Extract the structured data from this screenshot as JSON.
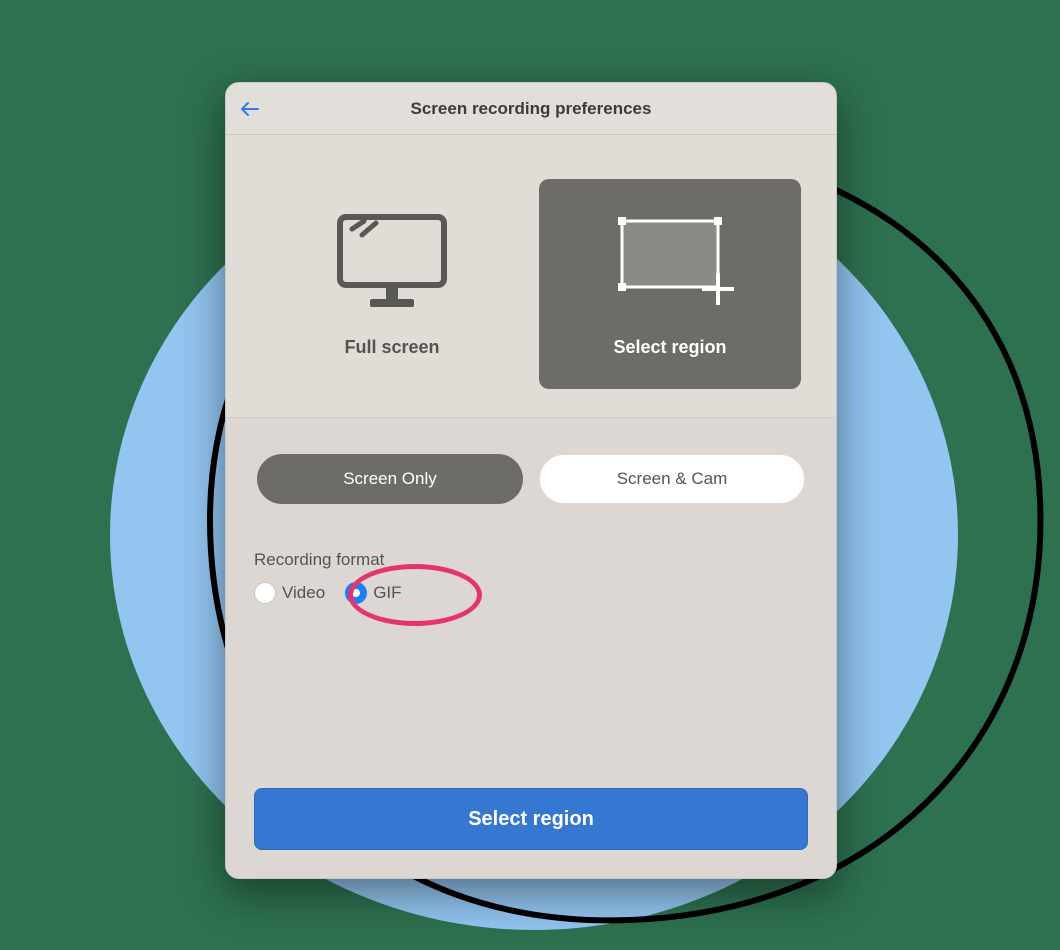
{
  "title": "Screen recording preferences",
  "captureModes": {
    "full": {
      "label": "Full screen",
      "selected": false
    },
    "region": {
      "label": "Select region",
      "selected": true
    }
  },
  "sourceModes": {
    "screenOnly": {
      "label": "Screen Only",
      "selected": true
    },
    "screenCam": {
      "label": "Screen & Cam",
      "selected": false
    }
  },
  "formatSection": {
    "heading": "Recording format",
    "options": {
      "video": {
        "label": "Video",
        "selected": false
      },
      "gif": {
        "label": "GIF",
        "selected": true
      }
    }
  },
  "primaryAction": {
    "label": "Select region"
  },
  "colors": {
    "background": "#2d7150",
    "circle": "#92c5f0",
    "accent": "#3677d1",
    "highlight": "#e6336e"
  },
  "icons": {
    "back": "arrow-left-icon",
    "fullScreen": "monitor-icon",
    "region": "crop-region-icon"
  }
}
